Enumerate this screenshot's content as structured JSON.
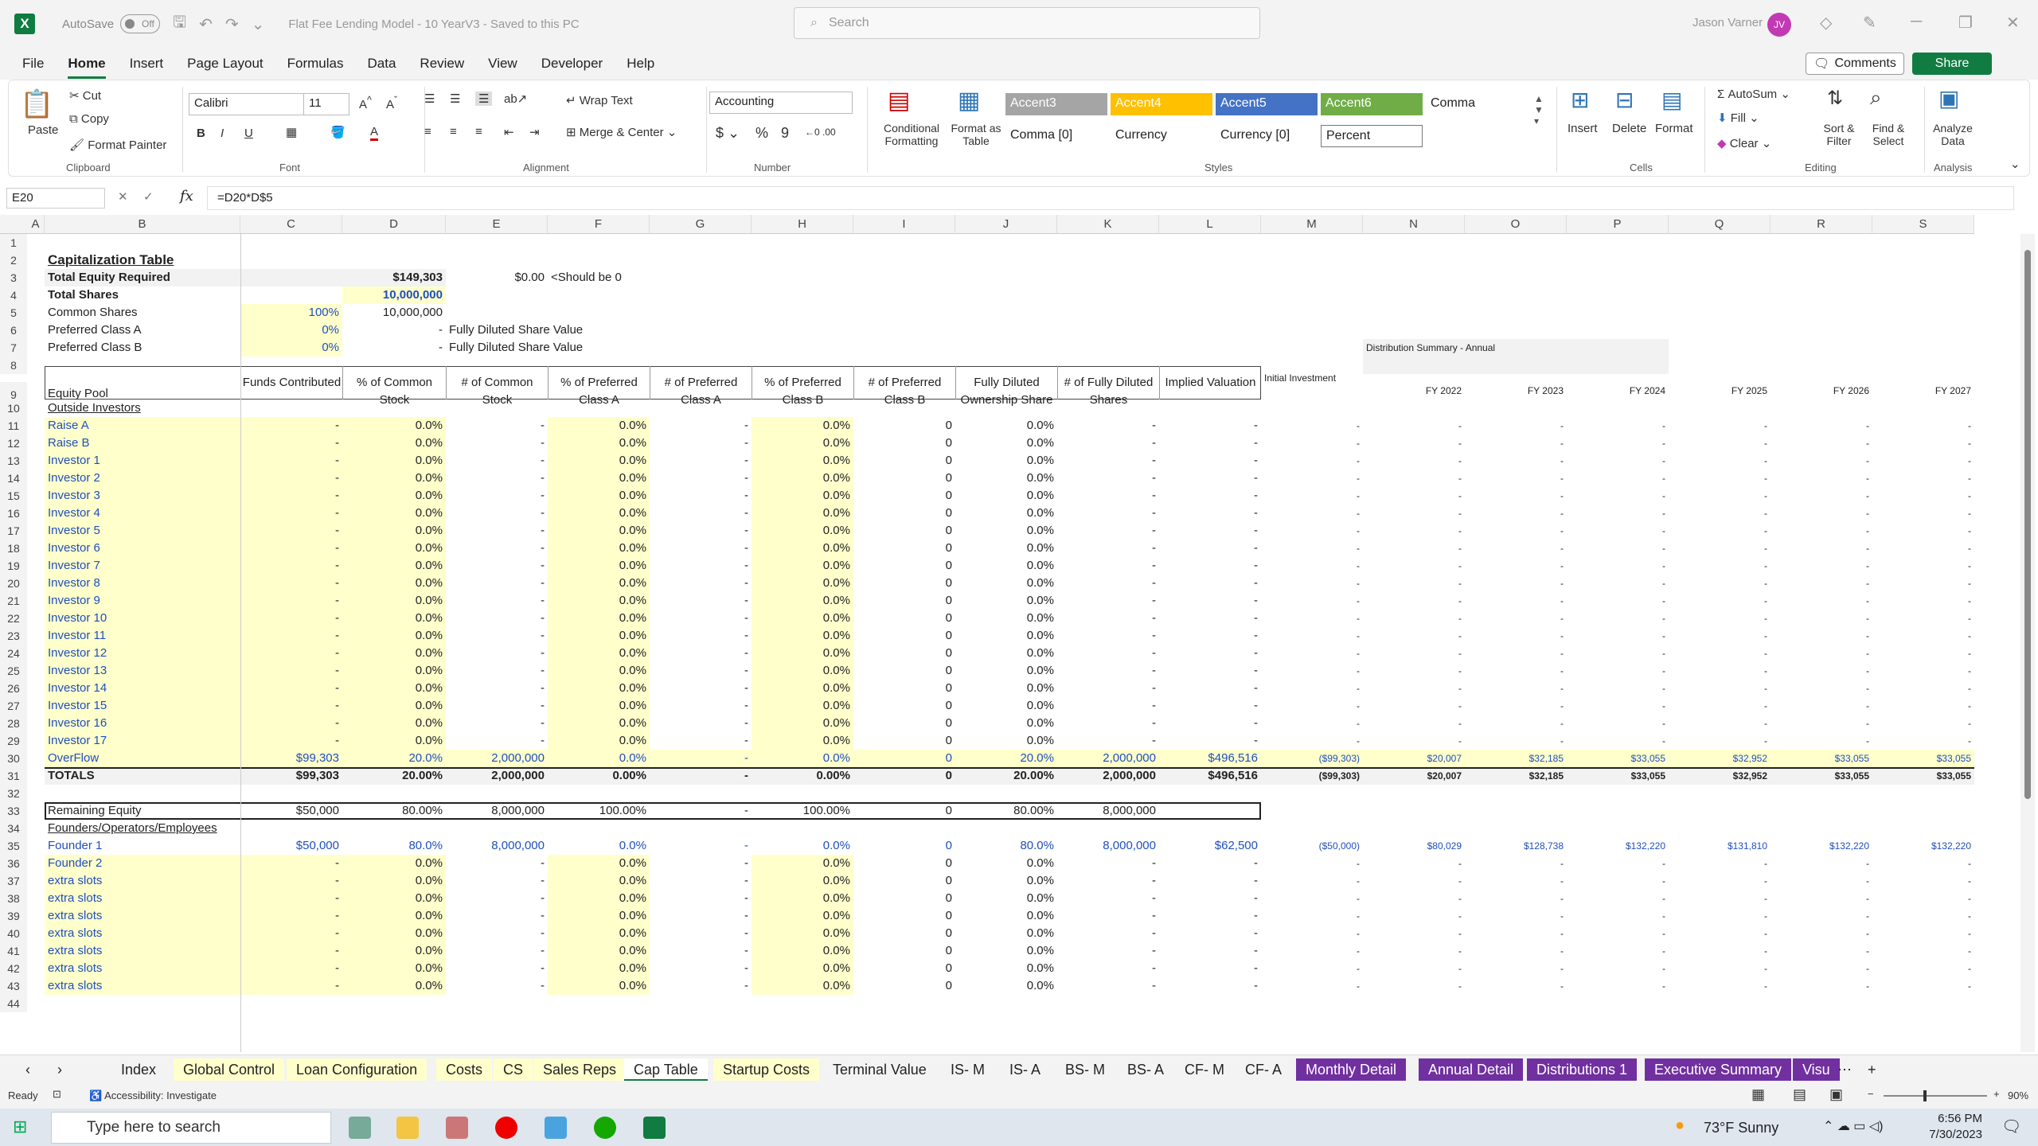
{
  "window": {
    "title": "Flat Fee Lending Model - 10 YearV3 - Saved to this PC",
    "autosave": "AutoSave",
    "autosave_state": "Off",
    "search_placeholder": "Search",
    "user": "Jason Varner",
    "initials": "JV"
  },
  "menu": [
    "File",
    "Home",
    "Insert",
    "Page Layout",
    "Formulas",
    "Data",
    "Review",
    "View",
    "Developer",
    "Help"
  ],
  "buttons": {
    "comments": "Comments",
    "share": "Share"
  },
  "ribbon": {
    "clipboard": {
      "paste": "Paste",
      "cut": "Cut",
      "copy": "Copy",
      "format_painter": "Format Painter",
      "label": "Clipboard"
    },
    "font": {
      "name": "Calibri",
      "size": "11",
      "label": "Font"
    },
    "alignment": {
      "wrap": "Wrap Text",
      "merge": "Merge & Center",
      "label": "Alignment"
    },
    "number": {
      "format": "Accounting",
      "label": "Number"
    },
    "styles": {
      "cond": "Conditional Formatting",
      "table": "Format as Table",
      "cells": [
        "Accent3",
        "Accent4",
        "Accent5",
        "Accent6",
        "Comma",
        "Comma [0]",
        "Currency",
        "Currency [0]",
        "Percent"
      ],
      "label": "Styles"
    },
    "cells": {
      "insert": "Insert",
      "delete": "Delete",
      "format": "Format",
      "label": "Cells"
    },
    "editing": {
      "autosum": "AutoSum",
      "fill": "Fill",
      "clear": "Clear",
      "sort": "Sort & Filter",
      "find": "Find & Select",
      "label": "Editing"
    },
    "analysis": {
      "analyze": "Analyze Data",
      "label": "Analysis"
    }
  },
  "namebox": "E20",
  "formula": "=D20*D$5",
  "columns": [
    "A",
    "B",
    "C",
    "D",
    "E",
    "F",
    "G",
    "H",
    "I",
    "J",
    "K",
    "L",
    "M",
    "N",
    "O",
    "P",
    "Q",
    "R",
    "S"
  ],
  "sheet": {
    "title": "Capitalization Table",
    "total_equity_label": "Total Equity Required",
    "total_equity": "$149,303",
    "check": "$0.00",
    "check_note": "<Should be 0",
    "total_shares_label": "Total Shares",
    "total_shares": "10,000,000",
    "common_label": "Common Shares",
    "common_pct": "100%",
    "common_val": "10,000,000",
    "prefa_label": "Preferred Class A",
    "prefa_pct": "0%",
    "prefa_val": "-",
    "fdsv": "Fully Diluted Share Value",
    "prefb_label": "Preferred Class B",
    "prefb_pct": "0%",
    "prefb_val": "-",
    "dist_summary": "Distribution Summary - Annual",
    "headers": [
      "Equity Pool",
      "Funds Contributed",
      "% of Common Stock",
      "# of Common Stock",
      "% of Preferred Class A",
      "# of Preferred Class A",
      "% of Preferred Class B",
      "# of Preferred Class B",
      "Fully Diluted Ownership Share",
      "# of Fully Diluted Shares",
      "Implied Valuation"
    ],
    "initial_investment": "Initial Investment",
    "fy": [
      "FY 2022",
      "FY 2023",
      "FY 2024",
      "FY 2025",
      "FY 2026",
      "FY 2027"
    ],
    "outside_label": "Outside Investors",
    "investors": [
      "Raise A",
      "Raise B",
      "Investor 1",
      "Investor 2",
      "Investor 3",
      "Investor 4",
      "Investor 5",
      "Investor 6",
      "Investor 7",
      "Investor 8",
      "Investor 9",
      "Investor 10",
      "Investor 11",
      "Investor 12",
      "Investor 13",
      "Investor 14",
      "Investor 15",
      "Investor 16",
      "Investor 17"
    ],
    "dash": "-",
    "zpct": "0.0%",
    "zero": "0",
    "overflow": {
      "label": "OverFlow",
      "funds": "$99,303",
      "pct": "20.0%",
      "common": "2,000,000",
      "pa": "0.0%",
      "pa_n": "-",
      "pb": "0.0%",
      "pb_n": "0",
      "fd": "20.0%",
      "fdn": "2,000,000",
      "val": "$496,516",
      "init": "($99,303)",
      "fy": [
        "$20,007",
        "$32,185",
        "$33,055",
        "$32,952",
        "$33,055",
        "$33,055"
      ]
    },
    "totals": {
      "label": "TOTALS",
      "funds": "$99,303",
      "pct": "20.00%",
      "common": "2,000,000",
      "pa": "0.00%",
      "pa_n": "-",
      "pb": "0.00%",
      "pb_n": "0",
      "fd": "20.00%",
      "fdn": "2,000,000",
      "val": "$496,516",
      "init": "($99,303)",
      "fy": [
        "$20,007",
        "$32,185",
        "$33,055",
        "$32,952",
        "$33,055",
        "$33,055"
      ]
    },
    "remaining": {
      "label": "Remaining Equity",
      "funds": "$50,000",
      "pct": "80.00%",
      "common": "8,000,000",
      "pa": "100.00%",
      "pa_n": "-",
      "pb": "100.00%",
      "pb_n": "0",
      "fd": "80.00%",
      "fdn": "8,000,000"
    },
    "founders_label": "Founders/Operators/Employees",
    "founder1": {
      "label": "Founder 1",
      "funds": "$50,000",
      "pct": "80.0%",
      "common": "8,000,000",
      "pa": "0.0%",
      "pa_n": "-",
      "pb": "0.0%",
      "pb_n": "0",
      "fd": "80.0%",
      "fdn": "8,000,000",
      "val": "$62,500",
      "init": "($50,000)",
      "fy": [
        "$80,029",
        "$128,738",
        "$132,220",
        "$131,810",
        "$132,220",
        "$132,220"
      ]
    },
    "founders": [
      "Founder 2",
      "extra slots",
      "extra slots",
      "extra slots",
      "extra slots",
      "extra slots",
      "extra slots",
      "extra slots"
    ]
  },
  "tabs": [
    "Index",
    "Global Control",
    "Loan Configuration",
    "Costs",
    "CS",
    "Sales Reps",
    "Cap Table",
    "Startup Costs",
    "Terminal Value",
    "IS- M",
    "IS- A",
    "BS- M",
    "BS- A",
    "CF- M",
    "CF- A",
    "Monthly Detail",
    "Annual Detail",
    "Distributions 1",
    "Executive Summary",
    "Visu"
  ],
  "status": {
    "ready": "Ready",
    "accessibility": "Accessibility: Investigate",
    "zoom": "90%"
  },
  "taskbar": {
    "search": "Type here to search",
    "weather": "73°F  Sunny",
    "time": "6:56 PM",
    "date": "7/30/2023"
  }
}
